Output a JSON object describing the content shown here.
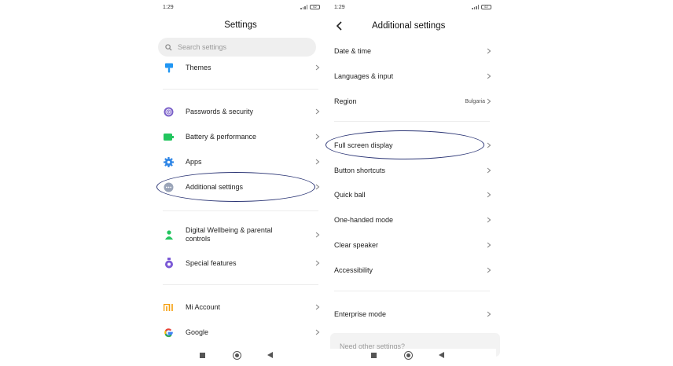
{
  "left": {
    "status": {
      "time": "1:29",
      "battery": "62"
    },
    "title": "Settings",
    "search": {
      "placeholder": "Search settings"
    },
    "items": [
      {
        "label": "Themes",
        "icon": "themes-icon",
        "color": "#2196f3"
      },
      {
        "label": "Passwords & security",
        "icon": "fingerprint-icon",
        "color": "#7b61c9"
      },
      {
        "label": "Battery & performance",
        "icon": "battery-icon",
        "color": "#22c55e"
      },
      {
        "label": "Apps",
        "icon": "gear-icon",
        "color": "#2f86e6"
      },
      {
        "label": "Additional settings",
        "icon": "more-dots-icon",
        "color": "#9aa4b8"
      },
      {
        "label": "Digital Wellbeing & parental controls",
        "icon": "wellbeing-icon",
        "color": "#22c55e"
      },
      {
        "label": "Special features",
        "icon": "special-features-icon",
        "color": "#7c5ad6"
      },
      {
        "label": "Mi Account",
        "icon": "mi-logo-icon",
        "color": "#f59e0b"
      },
      {
        "label": "Google",
        "icon": "google-icon",
        "color": "#4285f4"
      }
    ]
  },
  "right": {
    "status": {
      "time": "1:29",
      "battery": "62"
    },
    "title": "Additional settings",
    "items": [
      {
        "label": "Date & time"
      },
      {
        "label": "Languages & input"
      },
      {
        "label": "Region",
        "value": "Bulgaria"
      },
      {
        "label": "Full screen display"
      },
      {
        "label": "Button shortcuts"
      },
      {
        "label": "Quick ball"
      },
      {
        "label": "One-handed mode"
      },
      {
        "label": "Clear speaker"
      },
      {
        "label": "Accessibility"
      },
      {
        "label": "Enterprise mode"
      }
    ],
    "footer_card": "Need other settings?"
  },
  "colors": {
    "highlight_ellipse": "#2b3575"
  }
}
